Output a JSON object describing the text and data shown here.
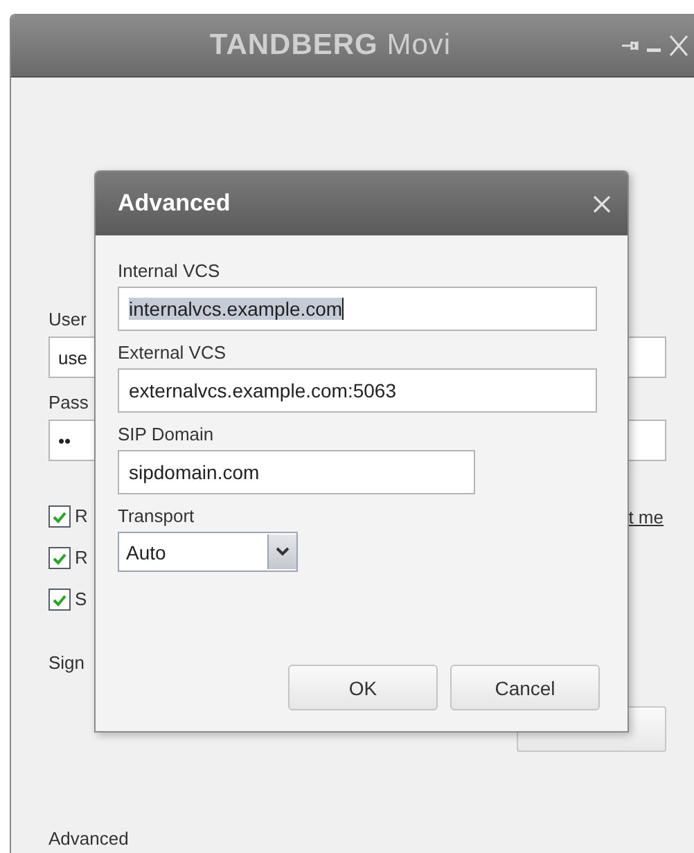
{
  "window": {
    "title": "**TANDBERG** Movi"
  },
  "sign_in_form": {
    "username_label": "User",
    "username_value": "use",
    "password_label": "Pass",
    "password_value": "••",
    "checkboxes": [
      {
        "label": "R",
        "checked": true
      },
      {
        "label": "R",
        "checked": true
      },
      {
        "label": "S",
        "checked": true
      }
    ],
    "link": "t me",
    "status_label": "Sign",
    "advanced_link": "Advanced"
  },
  "dialog": {
    "title": "Advanced",
    "fields": [
      {
        "kind": "text",
        "label": "Internal VCS",
        "value": "internalvcs.example.com",
        "text_selected": true,
        "wide": true
      },
      {
        "kind": "text",
        "label": "External VCS",
        "value": "externalvcs.example.com:5063",
        "text_selected": false,
        "wide": true
      },
      {
        "kind": "text",
        "label": "SIP Domain",
        "value": "sipdomain.com",
        "text_selected": false,
        "wide": false
      },
      {
        "kind": "select",
        "label": "Transport",
        "value": "Auto"
      }
    ],
    "buttons": [
      "OK",
      "Cancel"
    ]
  }
}
